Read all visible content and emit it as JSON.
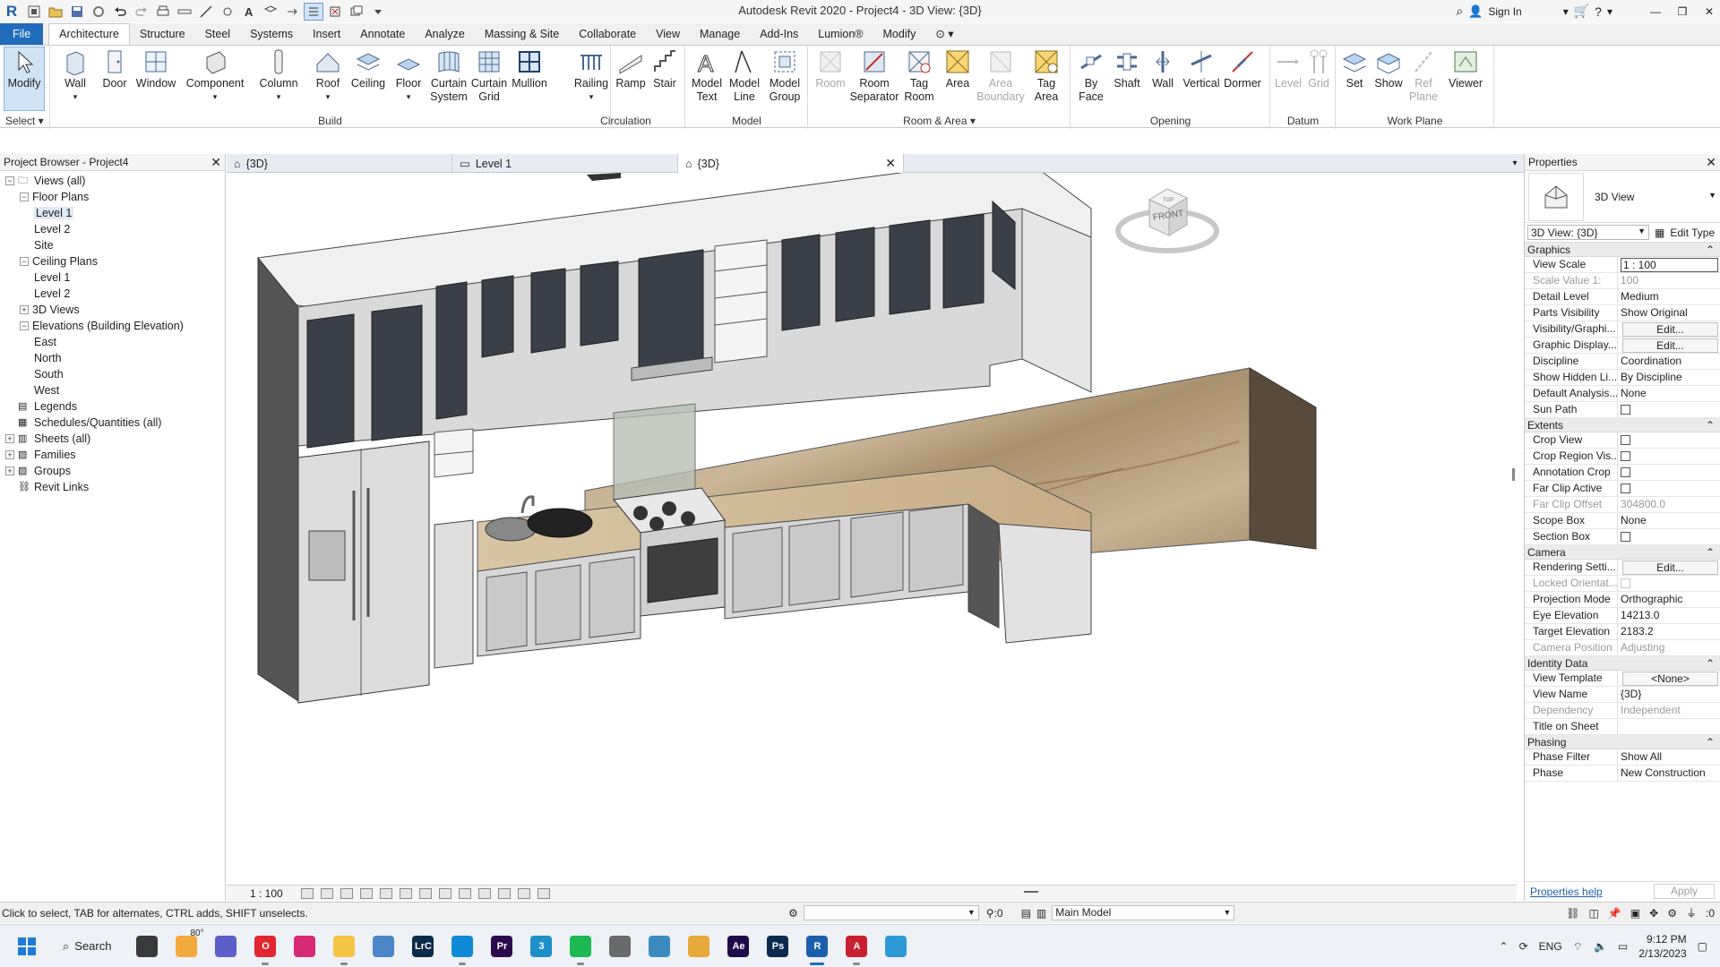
{
  "app": {
    "title": "Autodesk Revit 2020 - Project4 - 3D View: {3D}",
    "sign_in": "Sign In"
  },
  "ribbon_tabs": [
    "File",
    "Architecture",
    "Structure",
    "Steel",
    "Systems",
    "Insert",
    "Annotate",
    "Analyze",
    "Massing & Site",
    "Collaborate",
    "View",
    "Manage",
    "Add-Ins",
    "Lumion®",
    "Modify"
  ],
  "ribbon": {
    "select_label": "Select ▾",
    "panels": {
      "build": "Build",
      "circulation": "Circulation",
      "model": "Model",
      "room_area": "Room & Area ▾",
      "opening": "Opening",
      "datum": "Datum",
      "work_plane": "Work Plane"
    },
    "buttons": {
      "modify": "Modify",
      "wall": "Wall",
      "door": "Door",
      "window": "Window",
      "component": "Component",
      "column": "Column",
      "roof": "Roof",
      "ceiling": "Ceiling",
      "floor": "Floor",
      "curtain_system": "Curtain System",
      "curtain_grid": "Curtain Grid",
      "mullion": "Mullion",
      "railing": "Railing",
      "ramp": "Ramp",
      "stair": "Stair",
      "model_text": "Model Text",
      "model_line": "Model Line",
      "model_group": "Model Group",
      "room": "Room",
      "room_separator": "Room Separator",
      "tag_room": "Tag Room",
      "area": "Area",
      "area_boundary": "Area Boundary",
      "tag_area": "Tag Area",
      "by_face": "By Face",
      "shaft": "Shaft",
      "opening_wall": "Wall",
      "vertical": "Vertical",
      "dormer": "Dormer",
      "level": "Level",
      "grid": "Grid",
      "set": "Set",
      "show": "Show",
      "ref_plane": "Ref Plane",
      "viewer": "Viewer"
    }
  },
  "project_browser": {
    "title": "Project Browser - Project4",
    "tree": [
      {
        "label": "Views (all)",
        "indent": 0,
        "toggle": "−",
        "icon": "views"
      },
      {
        "label": "Floor Plans",
        "indent": 1,
        "toggle": "−"
      },
      {
        "label": "Level 1",
        "indent": 2,
        "selected": true
      },
      {
        "label": "Level 2",
        "indent": 2
      },
      {
        "label": "Site",
        "indent": 2
      },
      {
        "label": "Ceiling Plans",
        "indent": 1,
        "toggle": "−"
      },
      {
        "label": "Level 1",
        "indent": 2
      },
      {
        "label": "Level 2",
        "indent": 2
      },
      {
        "label": "3D Views",
        "indent": 1,
        "toggle": "+"
      },
      {
        "label": "Elevations (Building Elevation)",
        "indent": 1,
        "toggle": "−"
      },
      {
        "label": "East",
        "indent": 2
      },
      {
        "label": "North",
        "indent": 2
      },
      {
        "label": "South",
        "indent": 2
      },
      {
        "label": "West",
        "indent": 2
      },
      {
        "label": "Legends",
        "indent": 0,
        "icon": "legend"
      },
      {
        "label": "Schedules/Quantities (all)",
        "indent": 0,
        "icon": "schedule"
      },
      {
        "label": "Sheets (all)",
        "indent": 0,
        "toggle": "+",
        "icon": "sheet"
      },
      {
        "label": "Families",
        "indent": 0,
        "toggle": "+",
        "icon": "family"
      },
      {
        "label": "Groups",
        "indent": 0,
        "toggle": "+",
        "icon": "group"
      },
      {
        "label": "Revit Links",
        "indent": 0,
        "icon": "link"
      }
    ]
  },
  "view_tabs": [
    {
      "label": "{3D}",
      "active": false
    },
    {
      "label": "Level 1",
      "active": false
    },
    {
      "label": "{3D}",
      "active": true
    }
  ],
  "viewcube": {
    "face": "FRONT",
    "top": "TOP"
  },
  "view_control": {
    "scale": "1 : 100"
  },
  "properties": {
    "title": "Properties",
    "type_name": "3D View",
    "instance_selector": "3D View: {3D}",
    "edit_type": "Edit Type",
    "groups": [
      {
        "name": "Graphics",
        "rows": [
          {
            "n": "View Scale",
            "v": "1 : 100",
            "style": "edit"
          },
          {
            "n": "Scale Value    1:",
            "v": "100",
            "disabled": true
          },
          {
            "n": "Detail Level",
            "v": "Medium"
          },
          {
            "n": "Parts Visibility",
            "v": "Show Original"
          },
          {
            "n": "Visibility/Graphi...",
            "v": "Edit...",
            "style": "btn"
          },
          {
            "n": "Graphic Display...",
            "v": "Edit...",
            "style": "btn"
          },
          {
            "n": "Discipline",
            "v": "Coordination"
          },
          {
            "n": "Show Hidden Li...",
            "v": "By Discipline"
          },
          {
            "n": "Default Analysis...",
            "v": "None"
          },
          {
            "n": "Sun Path",
            "v": "",
            "style": "check"
          }
        ]
      },
      {
        "name": "Extents",
        "rows": [
          {
            "n": "Crop View",
            "v": "",
            "style": "check"
          },
          {
            "n": "Crop Region Vis...",
            "v": "",
            "style": "check"
          },
          {
            "n": "Annotation Crop",
            "v": "",
            "style": "check"
          },
          {
            "n": "Far Clip Active",
            "v": "",
            "style": "check"
          },
          {
            "n": "Far Clip Offset",
            "v": "304800.0",
            "disabled": true
          },
          {
            "n": "Scope Box",
            "v": "None"
          },
          {
            "n": "Section Box",
            "v": "",
            "style": "check"
          }
        ]
      },
      {
        "name": "Camera",
        "rows": [
          {
            "n": "Rendering Setti...",
            "v": "Edit...",
            "style": "btn"
          },
          {
            "n": "Locked Orientat...",
            "v": "",
            "style": "check",
            "disabled": true
          },
          {
            "n": "Projection Mode",
            "v": "Orthographic"
          },
          {
            "n": "Eye Elevation",
            "v": "14213.0"
          },
          {
            "n": "Target Elevation",
            "v": "2183.2"
          },
          {
            "n": "Camera Position",
            "v": "Adjusting",
            "disabled": true
          }
        ]
      },
      {
        "name": "Identity Data",
        "rows": [
          {
            "n": "View Template",
            "v": "<None>",
            "style": "btn"
          },
          {
            "n": "View Name",
            "v": "{3D}"
          },
          {
            "n": "Dependency",
            "v": "Independent",
            "disabled": true
          },
          {
            "n": "Title on Sheet",
            "v": ""
          }
        ]
      },
      {
        "name": "Phasing",
        "rows": [
          {
            "n": "Phase Filter",
            "v": "Show All"
          },
          {
            "n": "Phase",
            "v": "New Construction"
          }
        ]
      }
    ],
    "help_link": "Properties help",
    "apply": "Apply"
  },
  "status": {
    "hint": "Click to select, TAB for alternates, CTRL adds, SHIFT unselects.",
    "selection_count": ":0",
    "model": "Main Model",
    "filter_count": ":0"
  },
  "taskbar": {
    "search": "Search",
    "weather": "80°",
    "lang": "ENG",
    "time": "9:12 PM",
    "date": "2/13/2023",
    "apps": [
      {
        "name": "task-view",
        "color": "#3a3a3a",
        "text": ""
      },
      {
        "name": "weather",
        "color": "#f2a93b",
        "text": ""
      },
      {
        "name": "teams",
        "color": "#5b5fc7",
        "text": ""
      },
      {
        "name": "opera",
        "color": "#e3262f",
        "text": "O"
      },
      {
        "name": "instagram",
        "color": "#d62976",
        "text": ""
      },
      {
        "name": "file-explorer",
        "color": "#f5c443",
        "text": ""
      },
      {
        "name": "photos",
        "color": "#4a86c8",
        "text": ""
      },
      {
        "name": "lightroom-classic",
        "color": "#0c2a4a",
        "text": "LrC"
      },
      {
        "name": "edge",
        "color": "#0f8ad6",
        "text": ""
      },
      {
        "name": "premiere-pro",
        "color": "#2c0a4e",
        "text": "Pr"
      },
      {
        "name": "app-3",
        "color": "#1d8fc9",
        "text": "3"
      },
      {
        "name": "spotify",
        "color": "#1db954",
        "text": ""
      },
      {
        "name": "app-a",
        "color": "#6a6a6a",
        "text": ""
      },
      {
        "name": "app-b",
        "color": "#3a8ac0",
        "text": ""
      },
      {
        "name": "media",
        "color": "#e6a93a",
        "text": ""
      },
      {
        "name": "after-effects",
        "color": "#1f0b4a",
        "text": "Ae"
      },
      {
        "name": "photoshop",
        "color": "#0a2b4f",
        "text": "Ps"
      },
      {
        "name": "revit",
        "color": "#1b5fae",
        "text": "R"
      },
      {
        "name": "autocad",
        "color": "#c8202f",
        "text": "A"
      },
      {
        "name": "globe",
        "color": "#2d9ad6",
        "text": ""
      }
    ]
  }
}
